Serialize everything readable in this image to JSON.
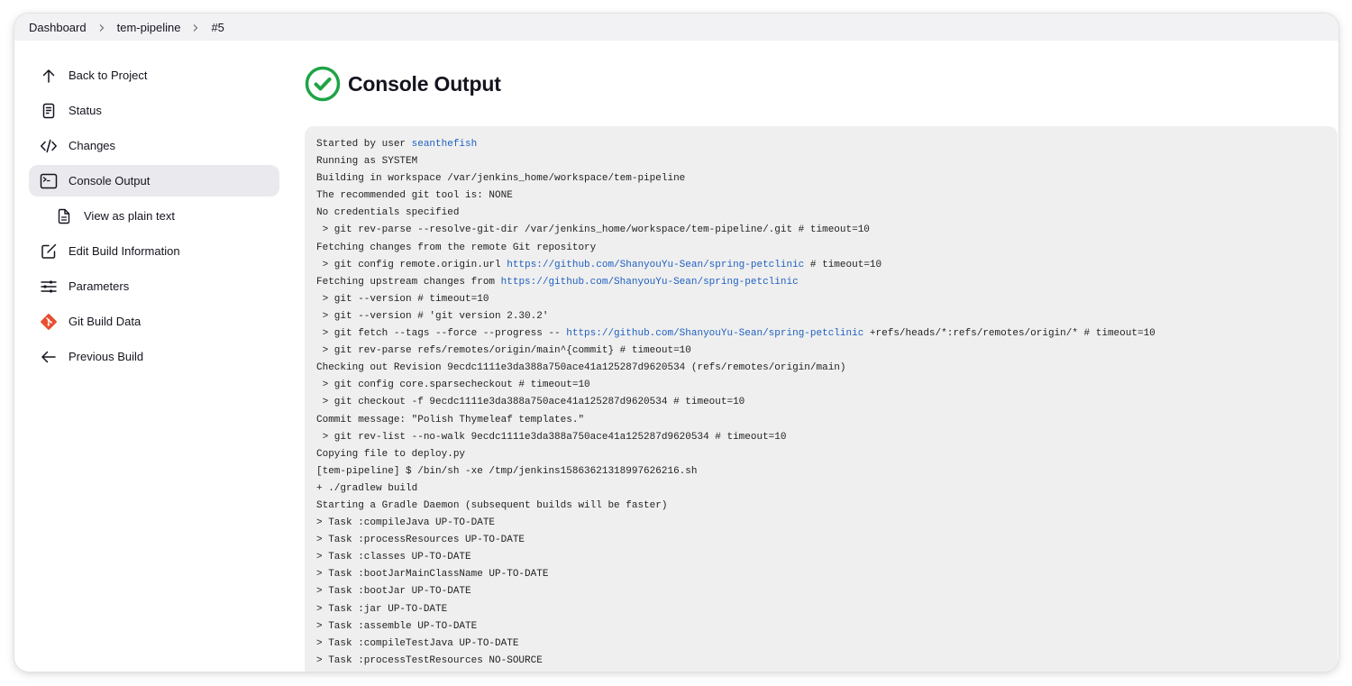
{
  "breadcrumb": {
    "items": [
      {
        "label": "Dashboard"
      },
      {
        "label": "tem-pipeline"
      },
      {
        "label": "#5"
      }
    ]
  },
  "sidebar": {
    "items": [
      {
        "label": "Back to Project",
        "icon": "arrow-up-icon"
      },
      {
        "label": "Status",
        "icon": "document-icon"
      },
      {
        "label": "Changes",
        "icon": "code-icon"
      },
      {
        "label": "Console Output",
        "icon": "terminal-icon",
        "active": true
      },
      {
        "label": "View as plain text",
        "icon": "text-file-icon"
      },
      {
        "label": "Edit Build Information",
        "icon": "edit-icon"
      },
      {
        "label": "Parameters",
        "icon": "sliders-icon"
      },
      {
        "label": "Git Build Data",
        "icon": "git-icon"
      },
      {
        "label": "Previous Build",
        "icon": "arrow-left-icon"
      }
    ]
  },
  "main": {
    "title": "Console Output",
    "status": "success",
    "status_color": "#1ea446",
    "link_color": "#2060c0"
  },
  "console": {
    "lines": [
      [
        {
          "t": "Started by user "
        },
        {
          "t": "seanthefish",
          "link": true
        }
      ],
      [
        {
          "t": "Running as SYSTEM"
        }
      ],
      [
        {
          "t": "Building in workspace /var/jenkins_home/workspace/tem-pipeline"
        }
      ],
      [
        {
          "t": "The recommended git tool is: NONE"
        }
      ],
      [
        {
          "t": "No credentials specified"
        }
      ],
      [
        {
          "t": " > git rev-parse --resolve-git-dir /var/jenkins_home/workspace/tem-pipeline/.git # timeout=10"
        }
      ],
      [
        {
          "t": "Fetching changes from the remote Git repository"
        }
      ],
      [
        {
          "t": " > git config remote.origin.url "
        },
        {
          "t": "https://github.com/ShanyouYu-Sean/spring-petclinic",
          "link": true
        },
        {
          "t": " # timeout=10"
        }
      ],
      [
        {
          "t": "Fetching upstream changes from "
        },
        {
          "t": "https://github.com/ShanyouYu-Sean/spring-petclinic",
          "link": true
        }
      ],
      [
        {
          "t": " > git --version # timeout=10"
        }
      ],
      [
        {
          "t": " > git --version # 'git version 2.30.2'"
        }
      ],
      [
        {
          "t": " > git fetch --tags --force --progress -- "
        },
        {
          "t": "https://github.com/ShanyouYu-Sean/spring-petclinic",
          "link": true
        },
        {
          "t": " +refs/heads/*:refs/remotes/origin/* # timeout=10"
        }
      ],
      [
        {
          "t": " > git rev-parse refs/remotes/origin/main^{commit} # timeout=10"
        }
      ],
      [
        {
          "t": "Checking out Revision 9ecdc1111e3da388a750ace41a125287d9620534 (refs/remotes/origin/main)"
        }
      ],
      [
        {
          "t": " > git config core.sparsecheckout # timeout=10"
        }
      ],
      [
        {
          "t": " > git checkout -f 9ecdc1111e3da388a750ace41a125287d9620534 # timeout=10"
        }
      ],
      [
        {
          "t": "Commit message: \"Polish Thymeleaf templates.\""
        }
      ],
      [
        {
          "t": " > git rev-list --no-walk 9ecdc1111e3da388a750ace41a125287d9620534 # timeout=10"
        }
      ],
      [
        {
          "t": "Copying file to deploy.py"
        }
      ],
      [
        {
          "t": "[tem-pipeline] $ /bin/sh -xe /tmp/jenkins15863621318997626216.sh"
        }
      ],
      [
        {
          "t": "+ ./gradlew build"
        }
      ],
      [
        {
          "t": "Starting a Gradle Daemon (subsequent builds will be faster)"
        }
      ],
      [
        {
          "t": "> Task :compileJava UP-TO-DATE"
        }
      ],
      [
        {
          "t": "> Task :processResources UP-TO-DATE"
        }
      ],
      [
        {
          "t": "> Task :classes UP-TO-DATE"
        }
      ],
      [
        {
          "t": "> Task :bootJarMainClassName UP-TO-DATE"
        }
      ],
      [
        {
          "t": "> Task :bootJar UP-TO-DATE"
        }
      ],
      [
        {
          "t": "> Task :jar UP-TO-DATE"
        }
      ],
      [
        {
          "t": "> Task :assemble UP-TO-DATE"
        }
      ],
      [
        {
          "t": "> Task :compileTestJava UP-TO-DATE"
        }
      ],
      [
        {
          "t": "> Task :processTestResources NO-SOURCE"
        }
      ]
    ]
  }
}
